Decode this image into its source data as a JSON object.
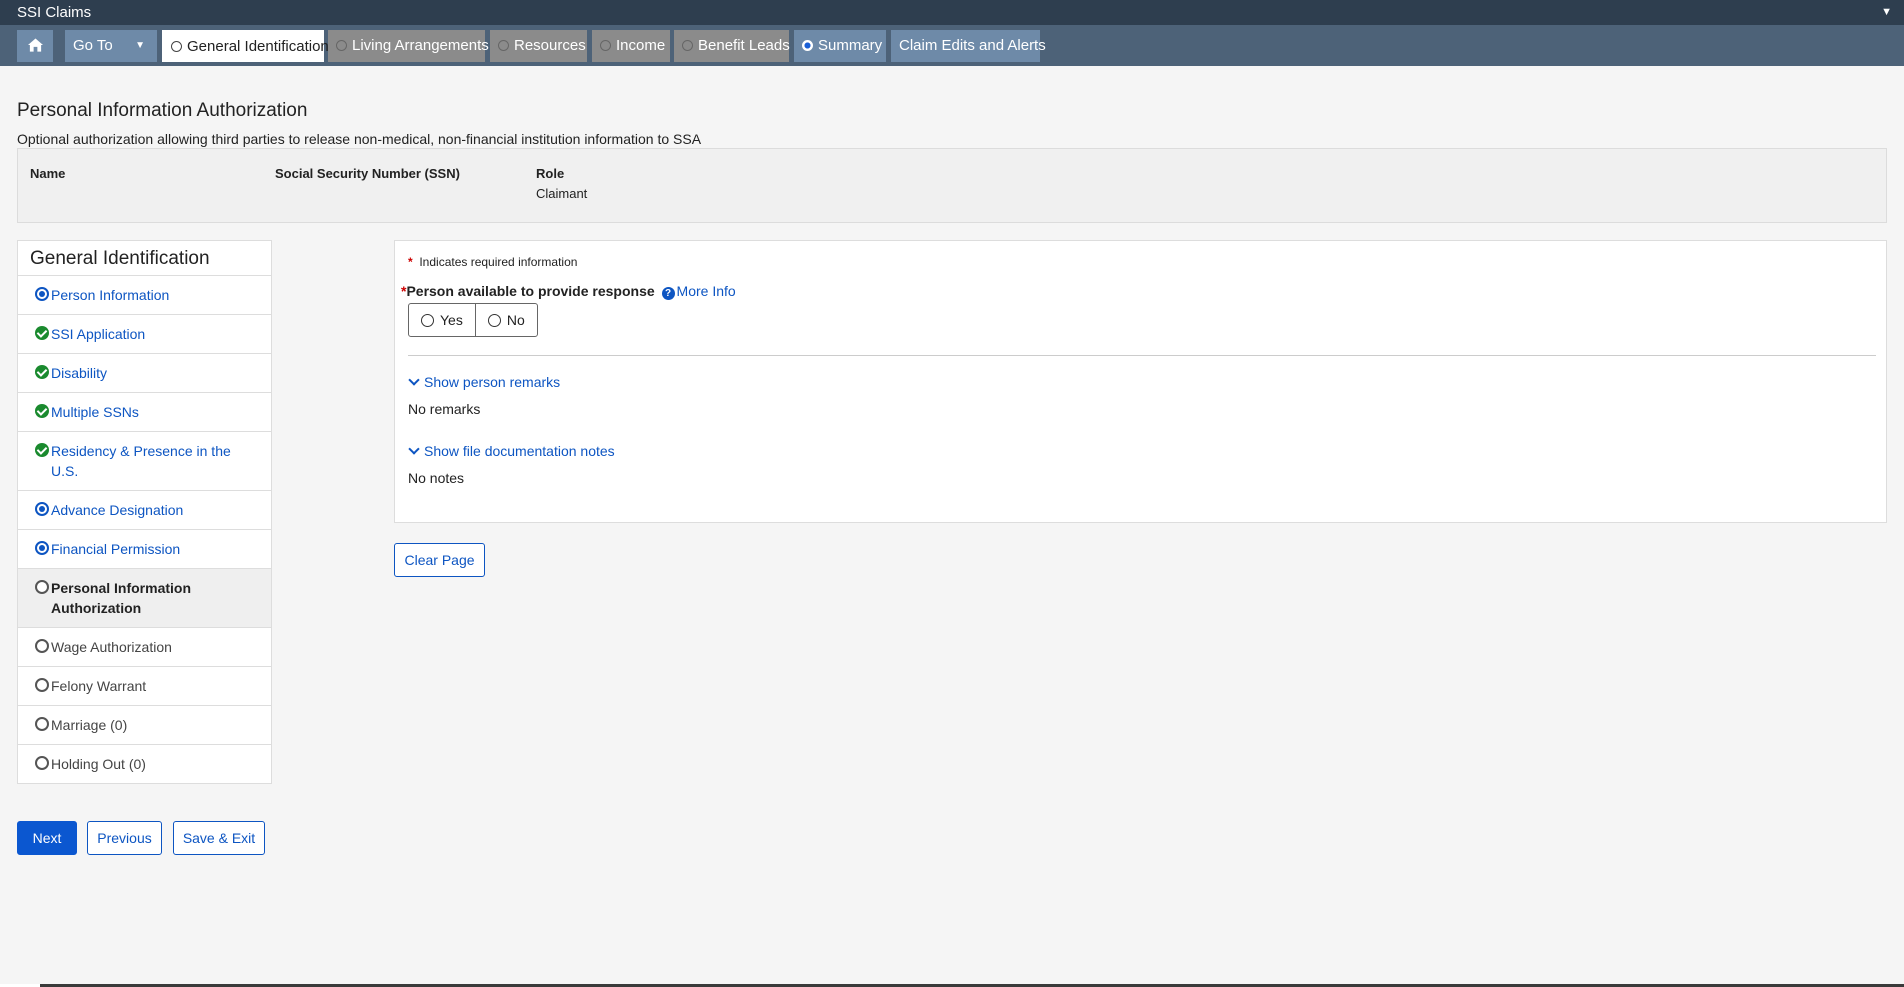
{
  "app": {
    "title": "SSI Claims"
  },
  "nav": {
    "goto_label": "Go To",
    "tabs": [
      {
        "label": "General Identification"
      },
      {
        "label": "Living Arrangements"
      },
      {
        "label": "Resources"
      },
      {
        "label": "Income"
      },
      {
        "label": "Benefit Leads"
      },
      {
        "label": "Summary"
      },
      {
        "label": "Claim Edits and Alerts"
      }
    ]
  },
  "page": {
    "title": "Personal Information Authorization",
    "subtitle": "Optional authorization allowing third parties to release non-medical, non-financial institution information to SSA"
  },
  "info": {
    "name_header": "Name",
    "name_value": "",
    "ssn_header": "Social Security Number (SSN)",
    "ssn_value": "",
    "role_header": "Role",
    "role_value": "Claimant"
  },
  "sidenav": {
    "title": "General Identification",
    "items": [
      {
        "label": "Person Information",
        "status": "selected"
      },
      {
        "label": "SSI Application",
        "status": "done"
      },
      {
        "label": "Disability",
        "status": "done"
      },
      {
        "label": "Multiple SSNs",
        "status": "done"
      },
      {
        "label": "Residency & Presence in the U.S.",
        "status": "done"
      },
      {
        "label": "Advance Designation",
        "status": "selected"
      },
      {
        "label": "Financial Permission",
        "status": "selected"
      },
      {
        "label": "Personal Information Authorization",
        "status": "current"
      },
      {
        "label": "Wage Authorization",
        "status": "empty"
      },
      {
        "label": "Felony Warrant",
        "status": "empty"
      },
      {
        "label": "Marriage (0)",
        "status": "empty"
      },
      {
        "label": "Holding Out (0)",
        "status": "empty"
      }
    ]
  },
  "form": {
    "required_note": "Indicates required information",
    "question": "Person available to provide response",
    "more_info": "More Info",
    "yes_label": "Yes",
    "no_label": "No",
    "show_person_remarks": "Show person remarks",
    "no_remarks": "No remarks",
    "show_file_notes": "Show file documentation notes",
    "no_notes": "No notes"
  },
  "buttons": {
    "clear_page": "Clear Page",
    "next": "Next",
    "previous": "Previous",
    "save_exit": "Save & Exit"
  },
  "colors": {
    "primary": "#0b57d0",
    "link": "#0d55c2",
    "done": "#1a8a2e",
    "nav_bg": "#4d6278"
  }
}
